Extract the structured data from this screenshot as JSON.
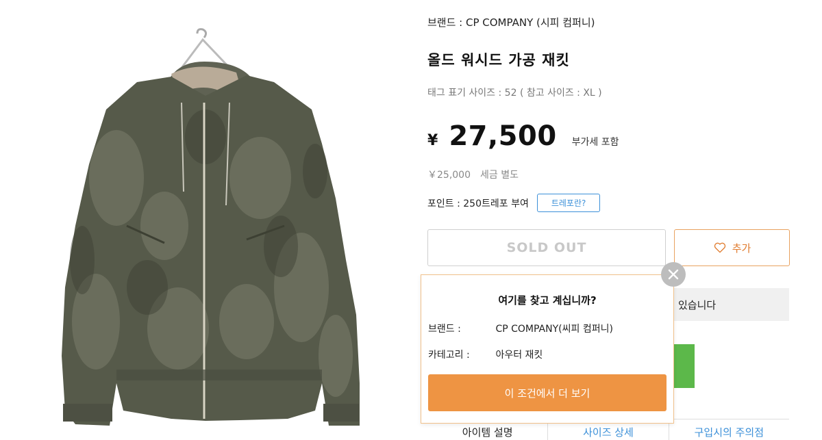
{
  "product": {
    "brand_line": "브랜드 : CP COMPANY (시피 컴퍼니)",
    "title": "올드 워시드 가공 재킷",
    "size_line": "태그 표기 사이즈 : 52 ( 참고 사이즈 : XL )",
    "currency": "¥",
    "price": "27,500",
    "tax_included": "부가세 포함",
    "price_ex_tax": "￥25,000　세금 별도",
    "points": "포인트 : 250트레포 부여",
    "points_help": "트레포란?"
  },
  "actions": {
    "soldout_label": "SOLD OUT",
    "favorite_label": "추가"
  },
  "stock_notice": {
    "text": "있습니다"
  },
  "popup": {
    "question": "여기를 찾고 계십니까?",
    "brand_key": "브랜드 :",
    "brand_value": "CP COMPANY(씨피 컴퍼니)",
    "category_key": "카테고리 :",
    "category_value": "아우터 재킷",
    "cta_label": "이 조건에서 더 보기"
  },
  "tabs": [
    "아이템 설명",
    "사이즈 상세",
    "구입시의 주의점"
  ],
  "colors": {
    "accent_orange": "#ee9443",
    "link_blue": "#3a8fd8",
    "popup_border": "#f0c089",
    "banner_green": "#5cb84a"
  }
}
